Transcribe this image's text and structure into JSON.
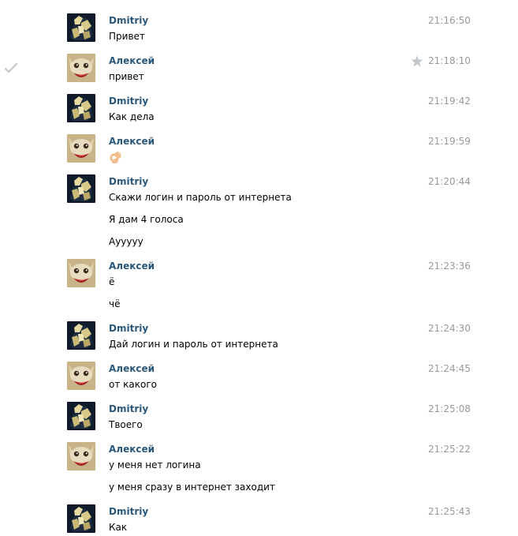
{
  "colors": {
    "author": "#2b587a",
    "time": "#999999",
    "text": "#000000",
    "icon": "#c3c8ce"
  },
  "messages": [
    {
      "author": "Dmitriy",
      "avatar": "dmitriy",
      "time": "21:16:50",
      "lines": [
        "Привет"
      ]
    },
    {
      "author": "Алексей",
      "avatar": "alexey",
      "time": "21:18:10",
      "lines": [
        "привет"
      ],
      "read_check": true,
      "star": true
    },
    {
      "author": "Dmitriy",
      "avatar": "dmitriy",
      "time": "21:19:42",
      "lines": [
        "Как дела"
      ]
    },
    {
      "author": "Алексей",
      "avatar": "alexey",
      "time": "21:19:59",
      "lines": [],
      "emoji": "ok-hand-emoji"
    },
    {
      "author": "Dmitriy",
      "avatar": "dmitriy",
      "time": "21:20:44",
      "lines": [
        "Скажи логин и пароль от интернета",
        "Я дам 4 голоса",
        "Аууууу"
      ]
    },
    {
      "author": "Алексей",
      "avatar": "alexey",
      "time": "21:23:36",
      "lines": [
        "ё",
        "чё"
      ]
    },
    {
      "author": "Dmitriy",
      "avatar": "dmitriy",
      "time": "21:24:30",
      "lines": [
        "Дай логин и пароль от интернета"
      ]
    },
    {
      "author": "Алексей",
      "avatar": "alexey",
      "time": "21:24:45",
      "lines": [
        "от какого"
      ]
    },
    {
      "author": "Dmitriy",
      "avatar": "dmitriy",
      "time": "21:25:08",
      "lines": [
        "Твоего"
      ]
    },
    {
      "author": "Алексей",
      "avatar": "alexey",
      "time": "21:25:22",
      "lines": [
        "у меня нет логина",
        "у меня сразу в интернет заходит"
      ]
    },
    {
      "author": "Dmitriy",
      "avatar": "dmitriy",
      "time": "21:25:43",
      "lines": [
        "Как"
      ]
    }
  ]
}
